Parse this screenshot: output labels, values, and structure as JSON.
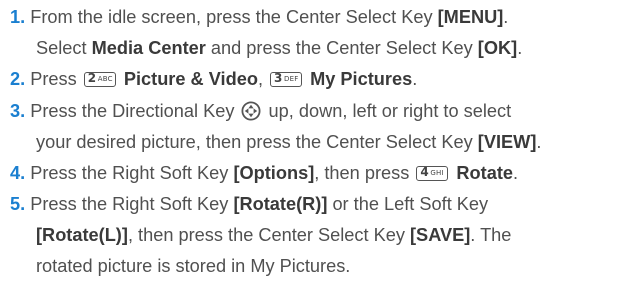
{
  "steps": [
    {
      "number": "1.",
      "lines": [
        [
          "From the idle screen, press the Center Select Key ",
          "[MENU]",
          "."
        ],
        [
          "Select ",
          "Media Center",
          " and press the Center Select Key ",
          "[OK]",
          "."
        ]
      ]
    },
    {
      "number": "2.",
      "text1": "Press ",
      "key1": {
        "digit": "2",
        "letters": "ABC"
      },
      "label1": " Picture & Video",
      "sep": ", ",
      "key2": {
        "digit": "3",
        "letters": "DEF"
      },
      "label2": " My Pictures",
      "end": "."
    },
    {
      "number": "3.",
      "line1": [
        "Press the Directional Key ",
        " up, down, left or right to select"
      ],
      "line2": [
        "your desired picture, then press the Center Select Key ",
        "[VIEW]",
        "."
      ],
      "icon": "directional-key-icon"
    },
    {
      "number": "4.",
      "text1": "Press the Right Soft Key ",
      "bold1": "[Options]",
      "text2": ", then press ",
      "key": {
        "digit": "4",
        "letters": "GHI"
      },
      "bold2": " Rotate",
      "end": "."
    },
    {
      "number": "5.",
      "line1": [
        "Press the Right Soft Key ",
        "[Rotate(R)]",
        " or the Left Soft Key"
      ],
      "line2": [
        "[Rotate(L)]",
        ", then press the Center Select Key ",
        "[SAVE]",
        ". The"
      ],
      "line3": "rotated picture is stored in My Pictures."
    }
  ]
}
